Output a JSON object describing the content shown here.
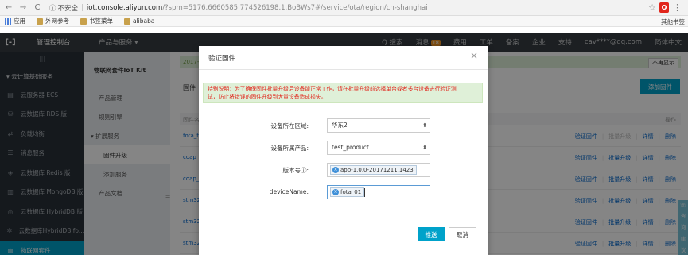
{
  "browser": {
    "back": "←",
    "forward": "→",
    "reload": "C",
    "security_label": "不安全",
    "url_host": "iot.console.aliyun.com",
    "url_path": "/?spm=5176.6660585.774526198.1.BoBWs7#/service/ota/region/cn-shanghai"
  },
  "bookmarks": {
    "apps": "应用",
    "items": [
      "外网参考",
      "书签菜单",
      "alibaba"
    ],
    "other": "其他书签"
  },
  "topnav": {
    "logo": "[-]",
    "console": "管理控制台",
    "products": "产品与服务 ▾",
    "search": "Q 搜索",
    "messages": "消息",
    "messages_count": "18",
    "billing": "费用",
    "tickets": "工单",
    "icp": "备案",
    "enterprise": "企业",
    "support": "支持",
    "account": "cav****@qq.com",
    "language": "简体中文"
  },
  "sidebar": {
    "collapse": "|||",
    "group": "▾ 云计算基础服务",
    "items": [
      {
        "icon": "▤",
        "label": "云服务器 ECS",
        "active": false
      },
      {
        "icon": "⛁",
        "label": "云数据库 RDS 版",
        "active": false
      },
      {
        "icon": "⇄",
        "label": "负载均衡",
        "active": false
      },
      {
        "icon": "☰",
        "label": "消息服务",
        "active": false
      },
      {
        "icon": "◈",
        "label": "云数据库 Redis 版",
        "active": false
      },
      {
        "icon": "▥",
        "label": "云数据库 MongoDB 版",
        "active": false
      },
      {
        "icon": "◎",
        "label": "云数据库 HybridDB 版",
        "active": false
      },
      {
        "icon": "✲",
        "label": "云数据库HybridDB fo...",
        "active": false
      },
      {
        "icon": "◍",
        "label": "物联网套件",
        "active": true
      }
    ]
  },
  "subside": {
    "title": "物联网套件IoT Kit",
    "items": [
      "产品管理",
      "规则引擎"
    ],
    "group": "▾ 扩展服务",
    "children": [
      "固件升级",
      "添加服务"
    ],
    "docs": "产品文档"
  },
  "main": {
    "notice": "2017-",
    "dismiss": "不再显示",
    "tab": "固件",
    "add_button": "添加固件",
    "col_name": "固件名",
    "col_ops": "操作",
    "rows": [
      {
        "name": "fota_te",
        "a1": "验证固件",
        "a2": "批量升级",
        "a3": "详情",
        "a4": "删除",
        "batch_disabled": true
      },
      {
        "name": "coap_",
        "a1": "验证固件",
        "a2": "批量升级",
        "a3": "详情",
        "a4": "删除",
        "batch_disabled": false
      },
      {
        "name": "coap_",
        "a1": "验证固件",
        "a2": "批量升级",
        "a3": "详情",
        "a4": "删除",
        "batch_disabled": false
      },
      {
        "name": "stm32",
        "a1": "验证固件",
        "a2": "批量升级",
        "a3": "详情",
        "a4": "删除",
        "batch_disabled": false
      },
      {
        "name": "stm32",
        "a1": "验证固件",
        "a2": "批量升级",
        "a3": "详情",
        "a4": "删除",
        "batch_disabled": false
      },
      {
        "name": "stm32",
        "a1": "验证固件",
        "a2": "批量升级",
        "a3": "详情",
        "a4": "删除",
        "batch_disabled": false
      }
    ]
  },
  "modal": {
    "title": "验证固件",
    "close": "×",
    "tip_line1": "特别说明：为了确保固件批量升级后设备能正常工作，请在批量升级前选择单台或者多台设备进行验证测",
    "tip_line2": "试，防止将错误的固件升级到大量设备造成损失。",
    "region_label": "设备所在区域:",
    "region_value": "华东2",
    "product_label": "设备所属产品:",
    "product_value": "test_product",
    "version_label": "版本号ⓘ:",
    "version_tag": "app-1.0.0-20171211.1423",
    "device_label": "deviceName:",
    "device_tag": "fota_01",
    "confirm": "推送",
    "cancel": "取消"
  },
  "right_panel": {
    "icon": "☏",
    "label1": "咨",
    "label2": "询",
    "label3": "建",
    "label4": "议"
  },
  "colors": {
    "topnav": "#373d41",
    "sidebar": "#293038",
    "accent": "#00a2ca",
    "notice_bg": "#dff0d8"
  }
}
